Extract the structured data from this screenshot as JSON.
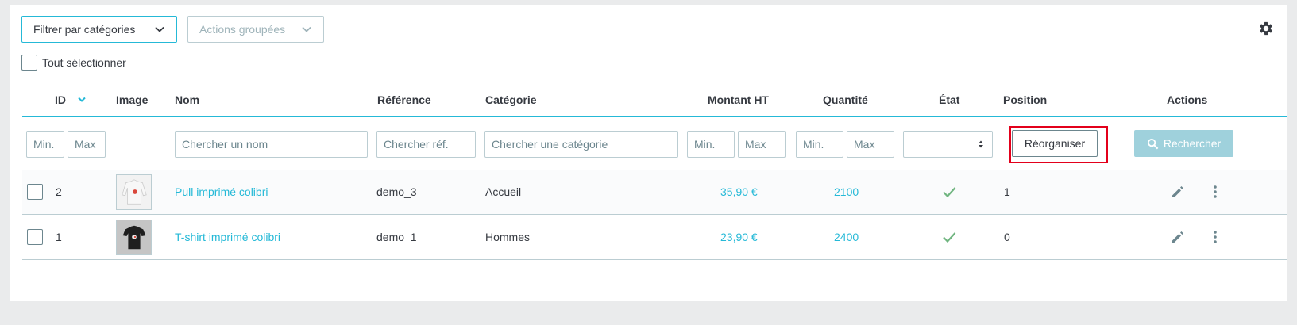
{
  "toolbar": {
    "filter_categories": "Filtrer par catégories",
    "bulk_actions": "Actions groupées",
    "select_all": "Tout sélectionner",
    "settings_icon": "gear-icon"
  },
  "table": {
    "headers": {
      "id": "ID",
      "image": "Image",
      "name": "Nom",
      "reference": "Référence",
      "category": "Catégorie",
      "price": "Montant HT",
      "quantity": "Quantité",
      "status": "État",
      "position": "Position",
      "actions": "Actions"
    },
    "filters": {
      "id_min": "Min.",
      "id_max": "Max",
      "name": "Chercher un nom",
      "reference": "Chercher réf.",
      "category": "Chercher une catégorie",
      "price_min": "Min.",
      "price_max": "Max",
      "qty_min": "Min.",
      "qty_max": "Max",
      "reorganize": "Réorganiser",
      "search": "Rechercher"
    },
    "rows": [
      {
        "id": "2",
        "name": "Pull imprimé colibri",
        "reference": "demo_3",
        "category": "Accueil",
        "price": "35,90 €",
        "quantity": "2100",
        "status": "active",
        "position": "1",
        "thumb": "white-sweater"
      },
      {
        "id": "1",
        "name": "T-shirt imprimé colibri",
        "reference": "demo_1",
        "category": "Hommes",
        "price": "23,90 €",
        "quantity": "2400",
        "status": "active",
        "position": "0",
        "thumb": "black-tshirt"
      }
    ]
  },
  "colors": {
    "accent": "#25b9d7",
    "success": "#70b580",
    "highlight": "#e3001b"
  }
}
